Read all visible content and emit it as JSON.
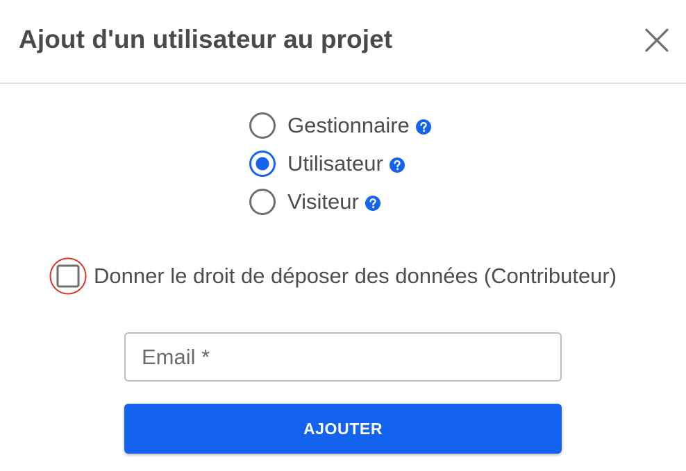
{
  "dialog": {
    "title": "Ajout d'un utilisateur au projet",
    "close_icon": "close-icon"
  },
  "roles": {
    "selected": "Utilisateur",
    "options": [
      {
        "label": "Gestionnaire",
        "selected": false,
        "help_icon": "question-circle-icon"
      },
      {
        "label": "Utilisateur",
        "selected": true,
        "help_icon": "question-circle-icon"
      },
      {
        "label": "Visiteur",
        "selected": false,
        "help_icon": "question-circle-icon"
      }
    ]
  },
  "contributor": {
    "label": "Donner le droit de déposer des données (Contributeur)",
    "checked": false,
    "highlighted": true
  },
  "email": {
    "value": "",
    "placeholder": "Email *"
  },
  "submit": {
    "label": "AJOUTER"
  },
  "colors": {
    "accent": "#1463ee",
    "text": "#4a4a4a",
    "border": "#bdbdbd",
    "radio_unselected": "#6e6e6e",
    "highlight_ring": "#e0302b"
  }
}
